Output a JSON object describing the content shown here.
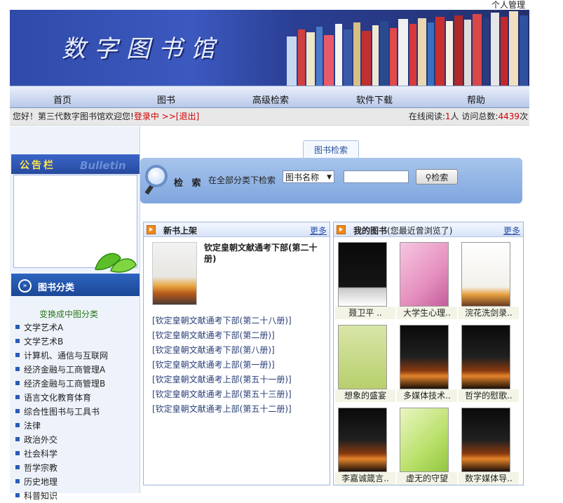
{
  "topbar": {
    "personal_label": "个人管理"
  },
  "banner": {
    "title": "数字图书馆"
  },
  "nav": {
    "items": [
      "首页",
      "图书",
      "高级检索",
      "软件下载",
      "帮助"
    ]
  },
  "welcome": {
    "greeting": "您好！第三代数字图书馆欢迎您!",
    "login": "登录中",
    "logout": ">>[退出]",
    "online_label": "在线阅读:",
    "online_count": "1",
    "online_unit": "人",
    "visits_label": "访问总数:",
    "visits_count": "4439",
    "visits_unit": "次"
  },
  "sidebar": {
    "bulletin_title": "公告栏",
    "bulletin_word": "Bulletin",
    "category_title": "图书分类",
    "switch_label": "变换成中图分类",
    "categories": [
      "文学艺术A",
      "文学艺术B",
      "计算机、通信与互联网",
      "经济金融与工商管理A",
      "经济金融与工商管理B",
      "语言文化教育体育",
      "综合性图书与工具书",
      "法律",
      "政治外交",
      "社会科学",
      "哲学宗教",
      "历史地理",
      "科普知识"
    ]
  },
  "search": {
    "tab": "图书检索",
    "label": "检 索",
    "scope": "在全部分类下检索",
    "field_selected": "图书名称",
    "keyword_value": "",
    "button": "检索"
  },
  "new_books": {
    "title": "新书上架",
    "more": "更多",
    "featured_title": "钦定皇朝文献通考下部(第二十册)",
    "links": [
      "[钦定皇朝文献通考下部(第二十八册)]",
      "[钦定皇朝文献通考下部(第二册)]",
      "[钦定皇朝文献通考下部(第八册)]",
      "[钦定皇朝文献通考上部(第一册)]",
      "[钦定皇朝文献通考上部(第五十一册)]",
      "[钦定皇朝文献通考上部(第五十三册)]",
      "[钦定皇朝文献通考上部(第五十二册)]"
    ]
  },
  "my_books": {
    "title": "我的图书",
    "subtitle": "(您最近曾浏览了)",
    "more": "更多",
    "books": [
      "聂卫平 ..",
      "大学生心理..",
      "浣花洗剑录..",
      "想象的盛宴",
      "多媒体技术..",
      "哲学的慰歌..",
      "李嘉诚箴言..",
      "虚无的守望",
      "数字媒体导.."
    ]
  }
}
